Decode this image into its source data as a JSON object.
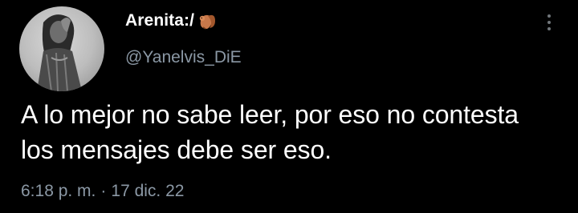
{
  "tweet": {
    "author": {
      "display_name": "Arenita:/",
      "name_emoji": "squirrel-emoji",
      "handle": "@Yanelvis_DiE",
      "avatar": "profile-photo"
    },
    "text": "A lo mejor no sabe leer, por eso no contesta los mensajes debe ser eso.",
    "time": "6:18 p. m.",
    "separator": "·",
    "date": "17 dic. 22",
    "menu_icon": "more-vertical-icon"
  },
  "colors": {
    "background": "#000000",
    "primary_text": "#ffffff",
    "secondary_text": "#8b98a5",
    "menu_dots": "#71767b"
  }
}
